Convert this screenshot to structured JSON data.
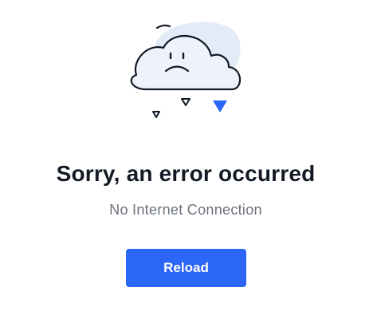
{
  "illustration": {
    "icon": "sad-cloud-icon",
    "colors": {
      "outline": "#131a26",
      "cloud_fill": "#eef3fb",
      "blob_fill": "#e3ebf8",
      "accent_drop": "#2b66f6"
    }
  },
  "error": {
    "title": "Sorry, an error occurred",
    "message": "No Internet Connection"
  },
  "actions": {
    "reload_label": "Reload",
    "button_color": "#2b66f6"
  }
}
